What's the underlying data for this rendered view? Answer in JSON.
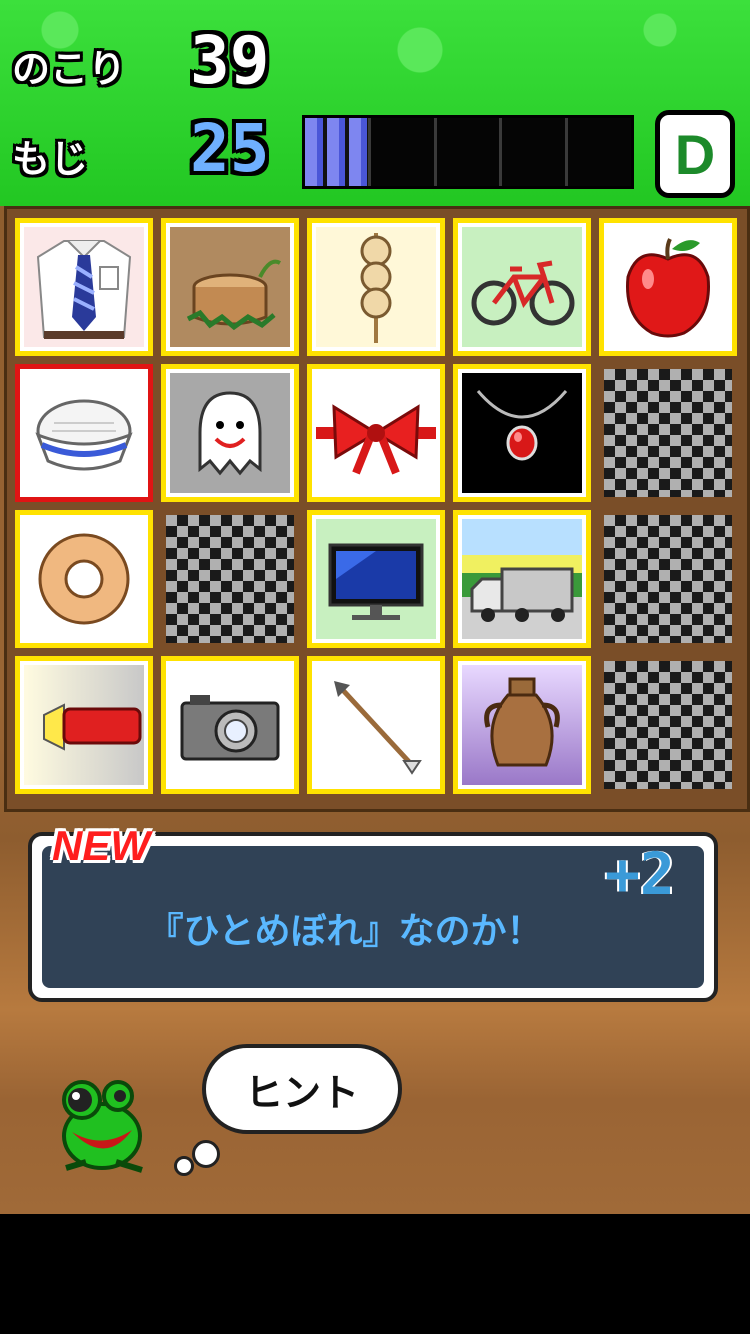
{
  "hud": {
    "remaining_label": "のこり",
    "remaining_value": "39",
    "letters_label": "もじ",
    "letters_value": "25",
    "progress_segments_filled": 1,
    "progress_segments_total": 5,
    "rank": "D",
    "colors": {
      "remaining_num": "#ffffff",
      "letters_num": "#6fb0ff",
      "rank_text": "#1c8a2a"
    }
  },
  "grid": {
    "rows": 4,
    "cols": 5,
    "cards": [
      {
        "icon": "shirt-tie-icon",
        "state": "found"
      },
      {
        "icon": "tree-stump-icon",
        "state": "found"
      },
      {
        "icon": "dango-icon",
        "state": "found"
      },
      {
        "icon": "bicycle-icon",
        "state": "found"
      },
      {
        "icon": "apple-icon",
        "state": "found"
      },
      {
        "icon": "rice-bowl-icon",
        "state": "selected"
      },
      {
        "icon": "ghost-icon",
        "state": "found"
      },
      {
        "icon": "ribbon-bow-icon",
        "state": "found"
      },
      {
        "icon": "pendant-necklace-icon",
        "state": "found"
      },
      {
        "icon": "hidden-card-icon",
        "state": "hidden"
      },
      {
        "icon": "donut-icon",
        "state": "found"
      },
      {
        "icon": "hidden-card-icon",
        "state": "hidden"
      },
      {
        "icon": "television-icon",
        "state": "found"
      },
      {
        "icon": "truck-icon",
        "state": "found"
      },
      {
        "icon": "hidden-card-icon",
        "state": "hidden"
      },
      {
        "icon": "flashlight-icon",
        "state": "found"
      },
      {
        "icon": "camera-icon",
        "state": "found"
      },
      {
        "icon": "arrow-icon",
        "state": "found"
      },
      {
        "icon": "vase-icon",
        "state": "found"
      },
      {
        "icon": "hidden-card-icon",
        "state": "hidden"
      }
    ]
  },
  "message": {
    "badge": "NEW",
    "text": "『ひとめぼれ』なのか！",
    "bonus": "+2"
  },
  "hint": {
    "label": "ヒント"
  },
  "mascot": {
    "icon": "frog-icon"
  }
}
